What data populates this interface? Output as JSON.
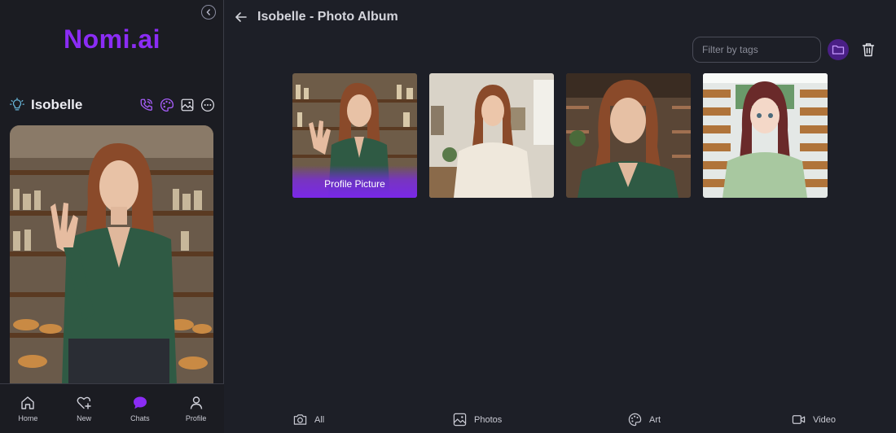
{
  "app": {
    "logo": "Nomi.ai"
  },
  "sidebar": {
    "persona_name": "Isobelle",
    "nav": [
      {
        "label": "Home",
        "icon": "home-icon",
        "active": false
      },
      {
        "label": "New",
        "icon": "heart-plus-icon",
        "active": false
      },
      {
        "label": "Chats",
        "icon": "chat-bubble-icon",
        "active": true
      },
      {
        "label": "Profile",
        "icon": "person-icon",
        "active": false
      }
    ]
  },
  "main": {
    "title": "Isobelle - Photo Album",
    "filter": {
      "placeholder": "Filter by tags",
      "value": ""
    },
    "gallery": [
      {
        "caption": "Profile Picture",
        "is_profile": true
      },
      {
        "caption": "",
        "is_profile": false
      },
      {
        "caption": "",
        "is_profile": false
      },
      {
        "caption": "",
        "is_profile": false
      }
    ],
    "tabs": [
      {
        "label": "All",
        "icon": "camera-icon"
      },
      {
        "label": "Photos",
        "icon": "image-icon"
      },
      {
        "label": "Art",
        "icon": "palette-icon"
      },
      {
        "label": "Video",
        "icon": "video-icon"
      }
    ]
  },
  "colors": {
    "accent": "#8b2cf5",
    "accent_soft": "#4a1f86",
    "background": "#1d1f27",
    "sidebar": "#1b1c22"
  }
}
